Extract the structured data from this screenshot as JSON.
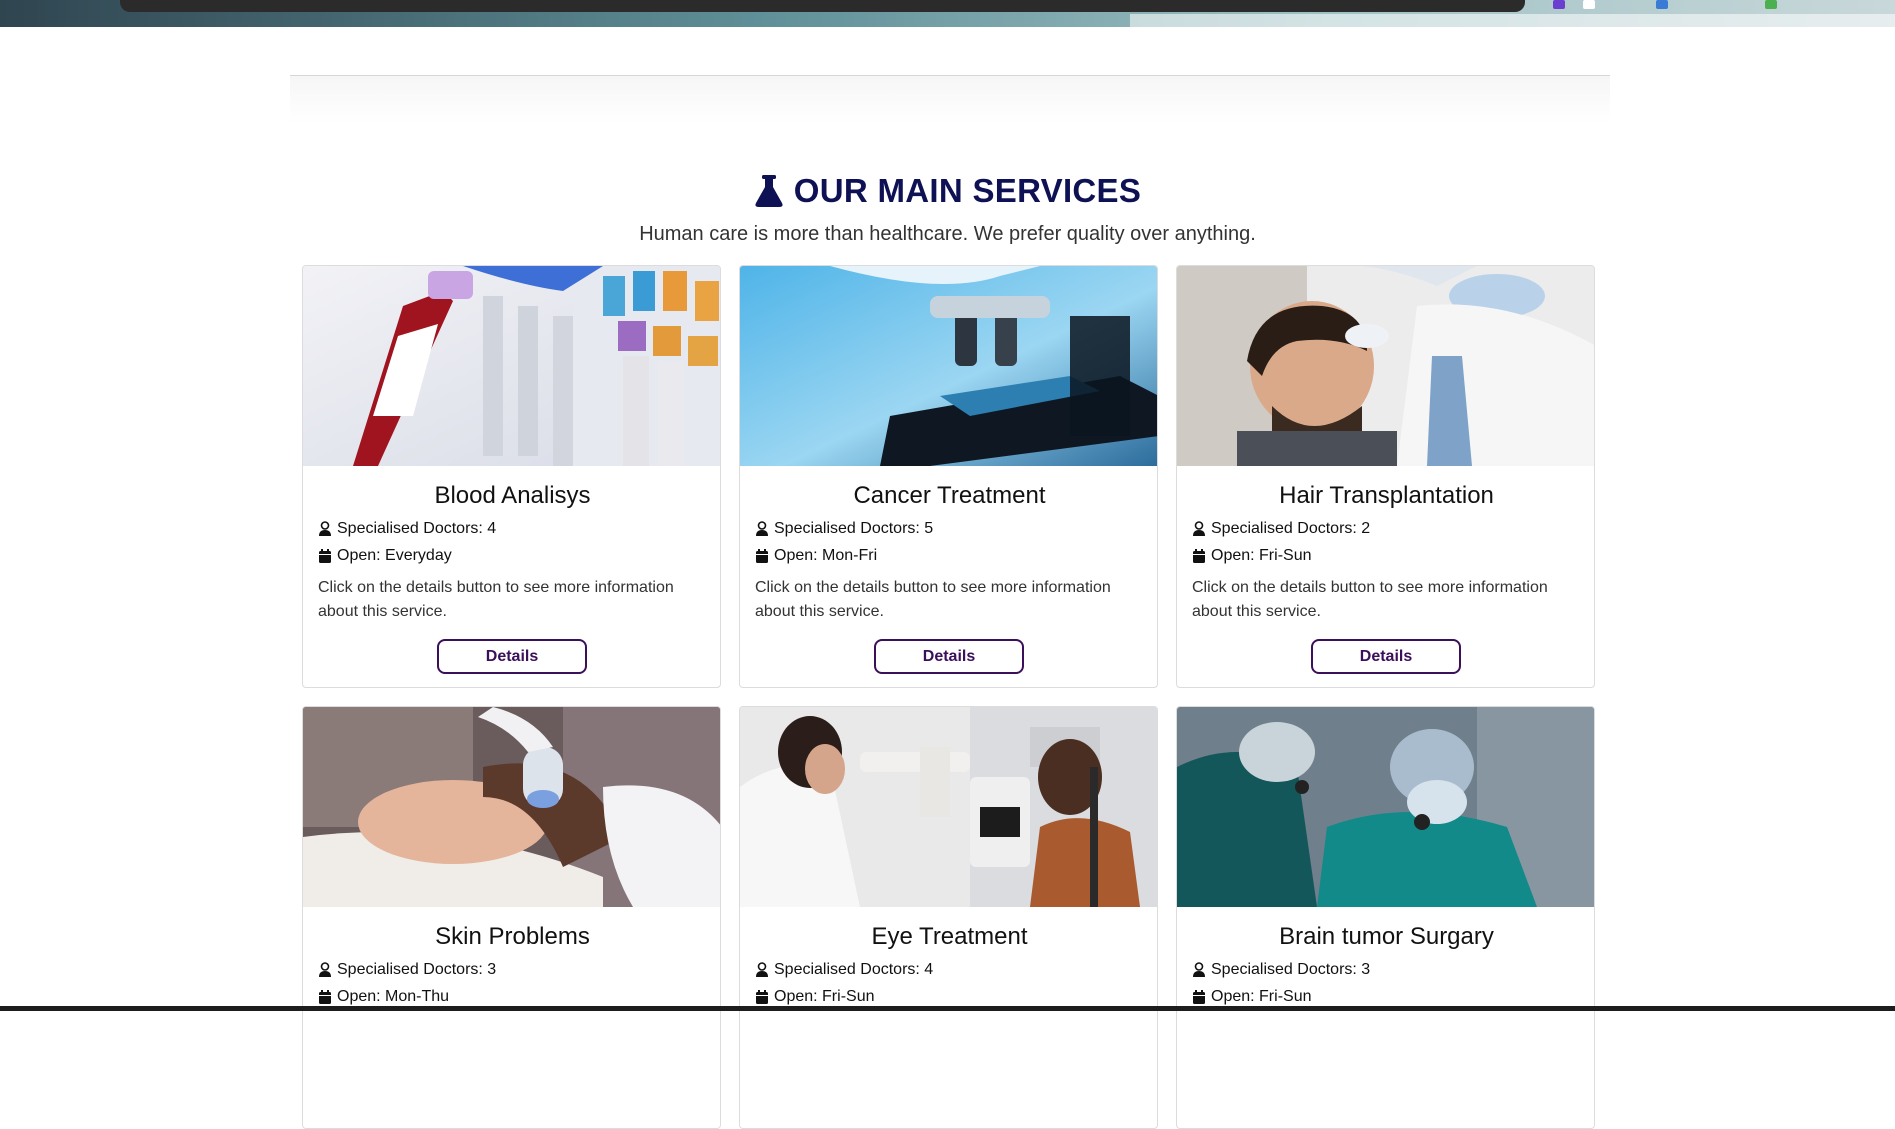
{
  "section": {
    "title": "OUR MAIN SERVICES",
    "subtitle": "Human care is more than healthcare. We prefer quality over anything."
  },
  "colors": {
    "title": "#0e1154",
    "button_border": "#3b0f5a"
  },
  "cards": [
    {
      "title": "Blood Analisys",
      "doctors": "Specialised Doctors: 4",
      "open": "Open: Everyday",
      "description": "Click on the details button to see more information about this service.",
      "button": "Details"
    },
    {
      "title": "Cancer Treatment",
      "doctors": "Specialised Doctors: 5",
      "open": "Open: Mon-Fri",
      "description": "Click on the details button to see more information about this service.",
      "button": "Details"
    },
    {
      "title": "Hair Transplantation",
      "doctors": "Specialised Doctors: 2",
      "open": "Open: Fri-Sun",
      "description": "Click on the details button to see more information about this service.",
      "button": "Details"
    },
    {
      "title": "Skin Problems",
      "doctors": "Specialised Doctors: 3",
      "open": "Open: Mon-Thu"
    },
    {
      "title": "Eye Treatment",
      "doctors": "Specialised Doctors: 4",
      "open": "Open: Fri-Sun"
    },
    {
      "title": "Brain tumor Surgary",
      "doctors": "Specialised Doctors: 3",
      "open": "Open: Fri-Sun"
    }
  ]
}
